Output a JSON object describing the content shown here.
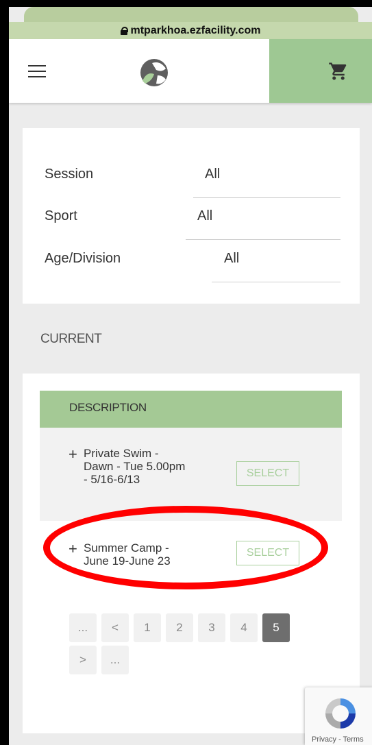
{
  "browser": {
    "url": "mtparkhoa.ezfacility.com"
  },
  "colors": {
    "accent_green": "#9ec893",
    "highlight_red": "#ff0000",
    "select_border": "#a8cf9c"
  },
  "header": {
    "menu_icon": "hamburger-icon",
    "cart_icon": "cart-icon",
    "logo": "facility-logo"
  },
  "filters": {
    "session": {
      "label": "Session",
      "value": "All"
    },
    "sport": {
      "label": "Sport",
      "value": "All"
    },
    "age": {
      "label": "Age/Division",
      "value": "All"
    }
  },
  "section_title": "CURRENT",
  "table": {
    "header": "DESCRIPTION",
    "rows": [
      {
        "expand": "+",
        "name": "Private Swim - Dawn - Tue 5.00pm - 5/16-6/13",
        "action": "SELECT"
      },
      {
        "expand": "+",
        "name": "Summer Camp - June 19-June 23",
        "action": "SELECT"
      }
    ]
  },
  "pagination": {
    "first_ellipsis": "...",
    "prev": "<",
    "pages": [
      "1",
      "2",
      "3",
      "4",
      "5"
    ],
    "current": "5",
    "next": ">",
    "last_ellipsis": "..."
  },
  "recaptcha": {
    "links": "Privacy - Terms"
  }
}
